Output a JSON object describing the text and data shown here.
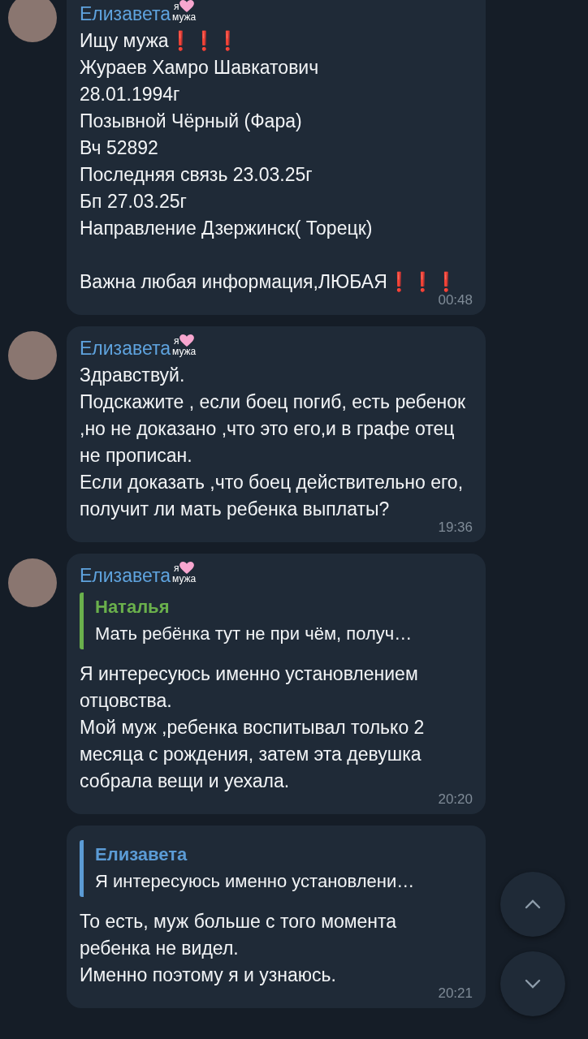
{
  "messages": [
    {
      "sender": {
        "name": "Елизавета",
        "badge_top": "я",
        "badge_bottom": "мужа"
      },
      "show_avatar": true,
      "blocks": [
        [
          "Ищу мужа❗❗❗",
          "Жураев Хамро Шавкатович",
          "28.01.1994г",
          "Позывной Чёрный (Фара)",
          "Вч 52892",
          "Последняя связь 23.03.25г",
          "Бп 27.03.25г",
          "Направление Дзержинск( Торецк)"
        ],
        [
          "Важна любая информация,ЛЮБАЯ❗❗❗"
        ]
      ],
      "time": "00:48"
    },
    {
      "sender": {
        "name": "Елизавета",
        "badge_top": "я",
        "badge_bottom": "мужа"
      },
      "show_avatar": true,
      "blocks": [
        [
          "Здравствуй.",
          "Подскажите , если боец погиб, есть ребенок ,но не доказано ,что это его,и в графе отец не прописан.",
          "Если доказать ,что боец действительно его, получит ли мать ребенка выплаты?"
        ]
      ],
      "time": "19:36"
    },
    {
      "sender": {
        "name": "Елизавета",
        "badge_top": "я",
        "badge_bottom": "мужа"
      },
      "show_avatar": true,
      "reply": {
        "name": "Наталья",
        "text": "Мать ребёнка тут не при чём, получ…",
        "color": "#6ab04c"
      },
      "blocks": [
        [
          "Я интересуюсь именно установлением отцовства.",
          "Мой муж ,ребенка воспитывал только 2 месяца с рождения, затем эта девушка собрала вещи и уехала."
        ]
      ],
      "time": "20:20"
    },
    {
      "show_avatar": false,
      "reply": {
        "name": "Елизавета",
        "text": "Я интересуюсь именно установлени…",
        "color": "#5b9bd5"
      },
      "blocks": [
        [
          "То есть, муж больше с того момента ребенка не видел.",
          "Именно поэтому я и узнаюсь."
        ]
      ],
      "time": "20:21"
    }
  ]
}
